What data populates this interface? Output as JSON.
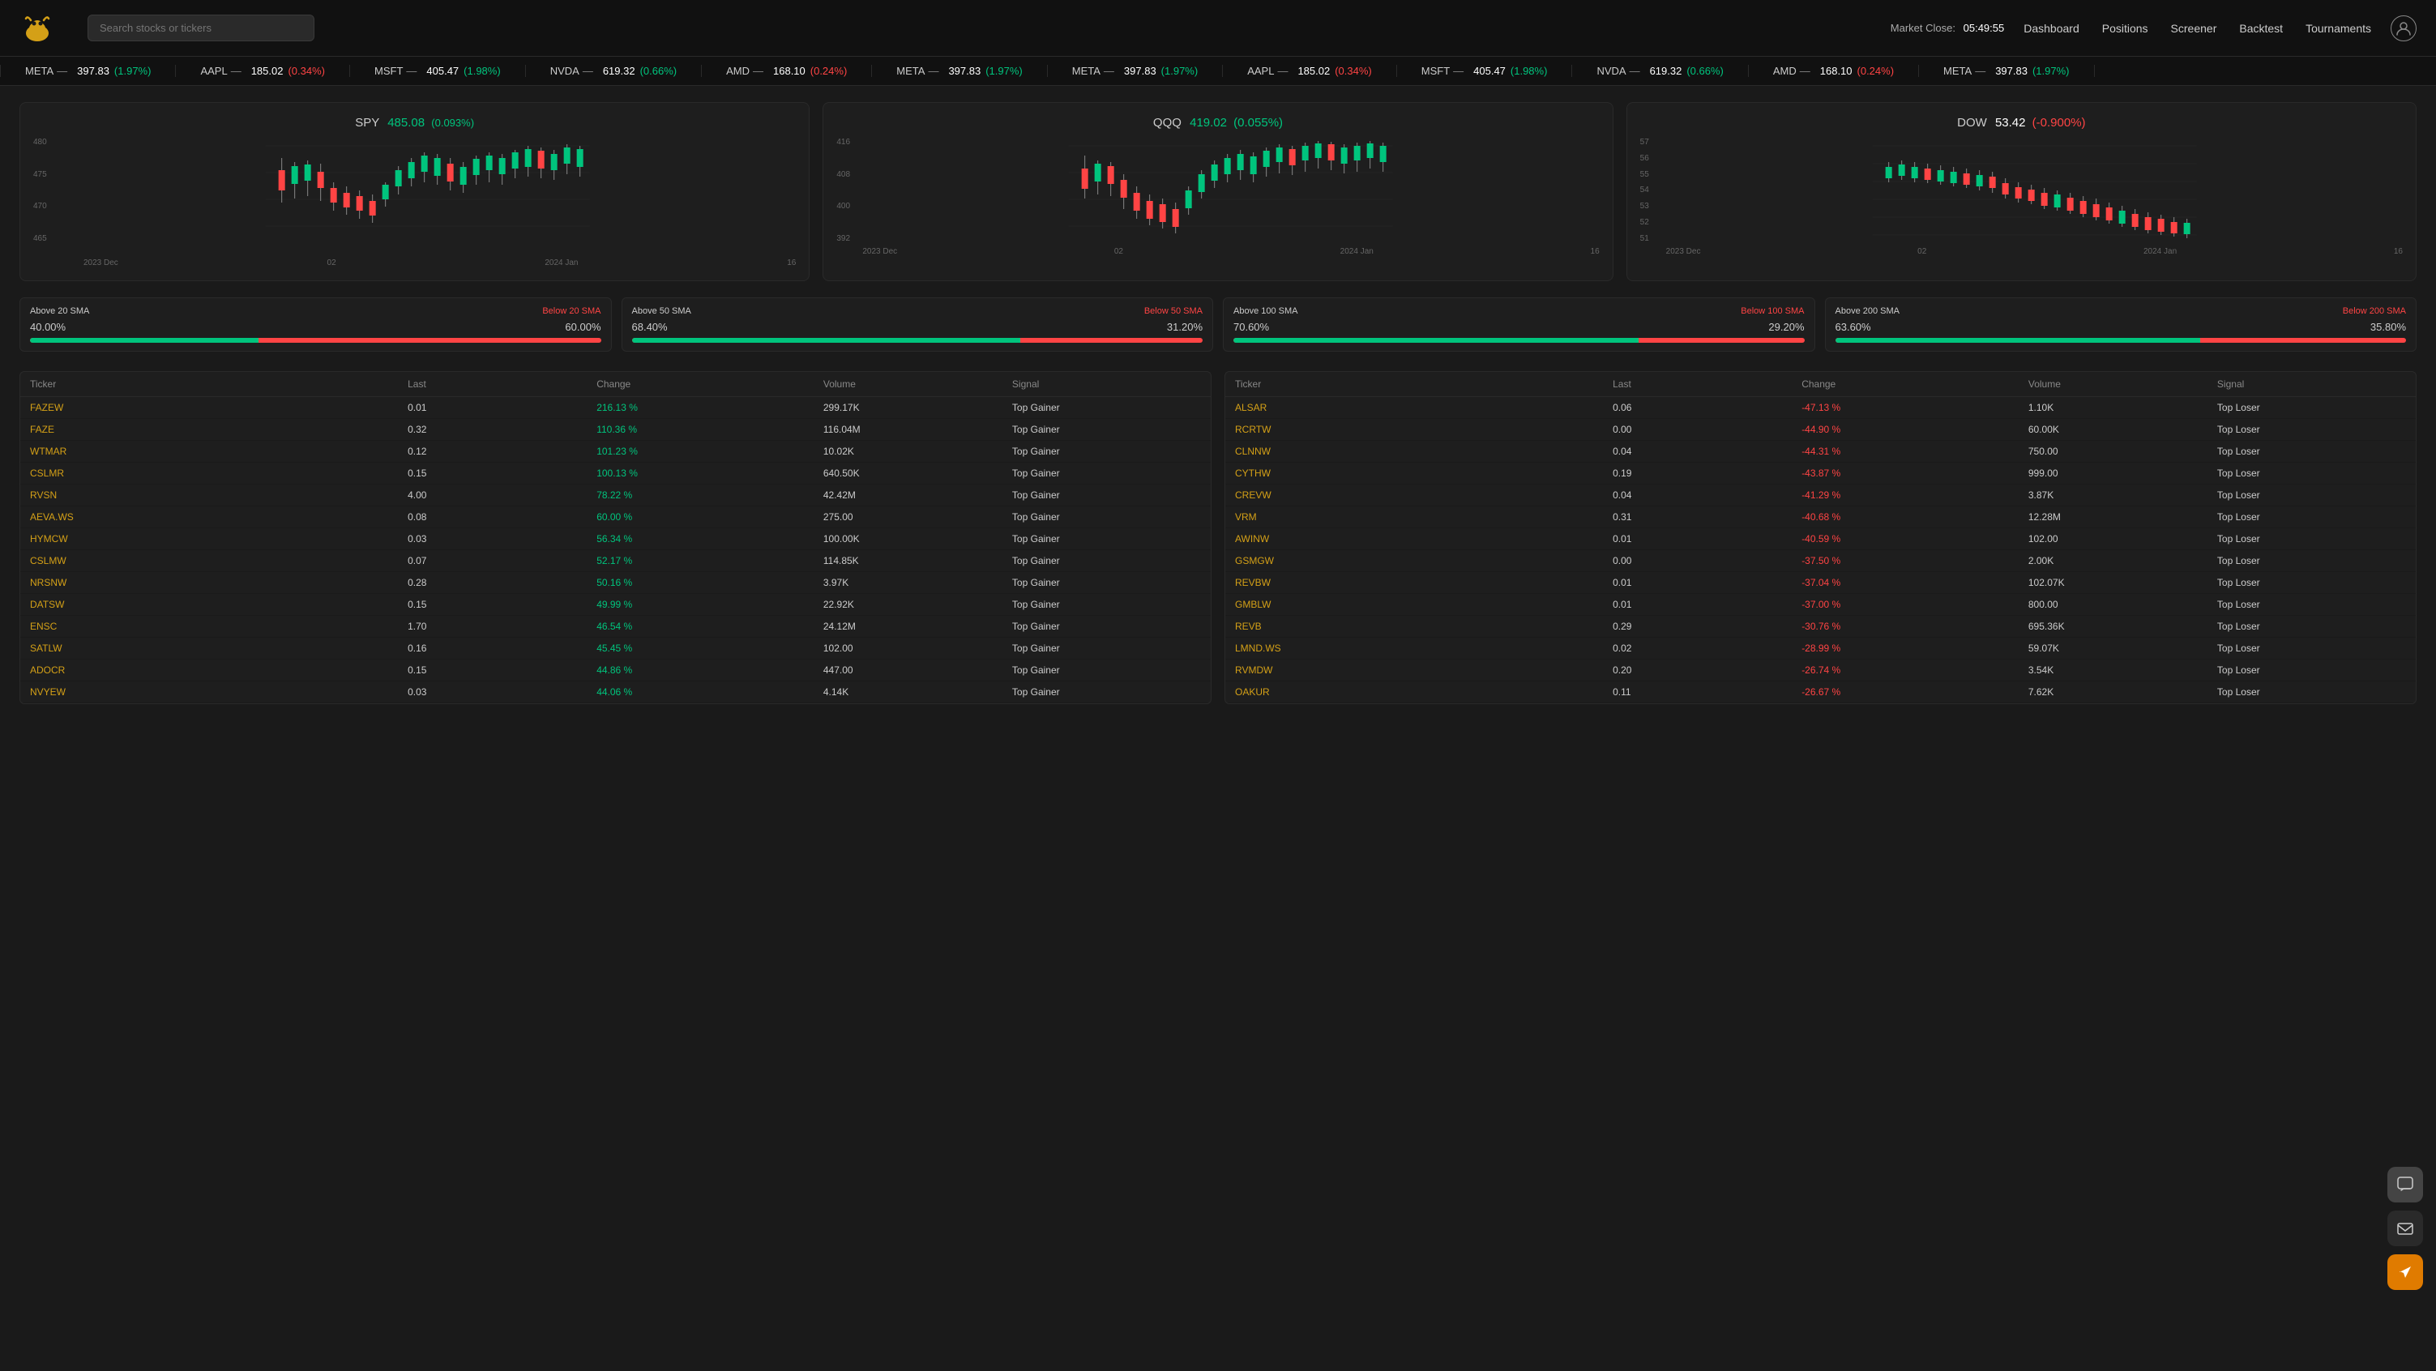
{
  "header": {
    "logo_emoji": "🐂",
    "search_placeholder": "Search stocks or tickers",
    "market_timer_label": "Market Close:",
    "market_timer_value": "05:49:55",
    "nav": [
      "Dashboard",
      "Positions",
      "Screener",
      "Backtest",
      "Tournaments"
    ]
  },
  "ticker_tape": [
    {
      "symbol": "META",
      "price": "397.83",
      "change": "(1.97%)",
      "positive": true
    },
    {
      "symbol": "AAPL",
      "price": "185.02",
      "change": "(0.34%)",
      "positive": false
    },
    {
      "symbol": "MSFT",
      "price": "405.47",
      "change": "(1.98%)",
      "positive": true
    },
    {
      "symbol": "NVDA",
      "price": "619.32",
      "change": "(0.66%)",
      "positive": true
    },
    {
      "symbol": "AMD",
      "price": "168.10",
      "change": "(0.24%)",
      "positive": false
    },
    {
      "symbol": "META",
      "price": "397.83",
      "change": "(1.97%)",
      "positive": true
    }
  ],
  "charts": [
    {
      "symbol": "SPY",
      "price": "485.08",
      "change": "(0.093%)",
      "positive": true,
      "y_labels": [
        "480",
        "475",
        "470",
        "465"
      ],
      "x_labels": [
        "2023 Dec",
        "02",
        "2024 Jan",
        "16"
      ]
    },
    {
      "symbol": "QQQ",
      "price": "419.02",
      "change": "(0.055%)",
      "positive": true,
      "y_labels": [
        "416",
        "408",
        "400",
        "392"
      ],
      "x_labels": [
        "2023 Dec",
        "02",
        "2024 Jan",
        "16"
      ]
    },
    {
      "symbol": "DOW",
      "price": "53.42",
      "change": "(-0.900%)",
      "positive": false,
      "y_labels": [
        "57",
        "56",
        "55",
        "54",
        "53",
        "52",
        "51"
      ],
      "x_labels": [
        "2023 Dec",
        "02",
        "2024 Jan",
        "16"
      ]
    }
  ],
  "sma_bars": [
    {
      "label_above": "Above 20 SMA",
      "label_below": "Below 20 SMA",
      "val_above": "40.00%",
      "val_below": "60.00%",
      "fill_pct": 40
    },
    {
      "label_above": "Above 50 SMA",
      "label_below": "Below 50 SMA",
      "val_above": "68.40%",
      "val_below": "31.20%",
      "fill_pct": 68
    },
    {
      "label_above": "Above 100 SMA",
      "label_below": "Below 100 SMA",
      "val_above": "70.60%",
      "val_below": "29.20%",
      "fill_pct": 71
    },
    {
      "label_above": "Above 200 SMA",
      "label_below": "Below 200 SMA",
      "val_above": "63.60%",
      "val_below": "35.80%",
      "fill_pct": 64
    }
  ],
  "gainers_table": {
    "columns": [
      "Ticker",
      "Last",
      "Change",
      "Volume",
      "Signal"
    ],
    "rows": [
      {
        "ticker": "FAZEW",
        "last": "0.01",
        "change": "216.13 %",
        "volume": "299.17K",
        "signal": "Top Gainer"
      },
      {
        "ticker": "FAZE",
        "last": "0.32",
        "change": "110.36 %",
        "volume": "116.04M",
        "signal": "Top Gainer"
      },
      {
        "ticker": "WTMAR",
        "last": "0.12",
        "change": "101.23 %",
        "volume": "10.02K",
        "signal": "Top Gainer"
      },
      {
        "ticker": "CSLMR",
        "last": "0.15",
        "change": "100.13 %",
        "volume": "640.50K",
        "signal": "Top Gainer"
      },
      {
        "ticker": "RVSN",
        "last": "4.00",
        "change": "78.22 %",
        "volume": "42.42M",
        "signal": "Top Gainer"
      },
      {
        "ticker": "AEVA.WS",
        "last": "0.08",
        "change": "60.00 %",
        "volume": "275.00",
        "signal": "Top Gainer"
      },
      {
        "ticker": "HYMCW",
        "last": "0.03",
        "change": "56.34 %",
        "volume": "100.00K",
        "signal": "Top Gainer"
      },
      {
        "ticker": "CSLMW",
        "last": "0.07",
        "change": "52.17 %",
        "volume": "114.85K",
        "signal": "Top Gainer"
      },
      {
        "ticker": "NRSNW",
        "last": "0.28",
        "change": "50.16 %",
        "volume": "3.97K",
        "signal": "Top Gainer"
      },
      {
        "ticker": "DATSW",
        "last": "0.15",
        "change": "49.99 %",
        "volume": "22.92K",
        "signal": "Top Gainer"
      },
      {
        "ticker": "ENSC",
        "last": "1.70",
        "change": "46.54 %",
        "volume": "24.12M",
        "signal": "Top Gainer"
      },
      {
        "ticker": "SATLW",
        "last": "0.16",
        "change": "45.45 %",
        "volume": "102.00",
        "signal": "Top Gainer"
      },
      {
        "ticker": "ADOCR",
        "last": "0.15",
        "change": "44.86 %",
        "volume": "447.00",
        "signal": "Top Gainer"
      },
      {
        "ticker": "NVYEW",
        "last": "0.03",
        "change": "44.06 %",
        "volume": "4.14K",
        "signal": "Top Gainer"
      }
    ]
  },
  "losers_table": {
    "columns": [
      "Ticker",
      "Last",
      "Change",
      "Volume",
      "Signal"
    ],
    "rows": [
      {
        "ticker": "ALSAR",
        "last": "0.06",
        "change": "-47.13 %",
        "volume": "1.10K",
        "signal": "Top Loser"
      },
      {
        "ticker": "RCRTW",
        "last": "0.00",
        "change": "-44.90 %",
        "volume": "60.00K",
        "signal": "Top Loser"
      },
      {
        "ticker": "CLNNW",
        "last": "0.04",
        "change": "-44.31 %",
        "volume": "750.00",
        "signal": "Top Loser"
      },
      {
        "ticker": "CYTHW",
        "last": "0.19",
        "change": "-43.87 %",
        "volume": "999.00",
        "signal": "Top Loser"
      },
      {
        "ticker": "CREVW",
        "last": "0.04",
        "change": "-41.29 %",
        "volume": "3.87K",
        "signal": "Top Loser"
      },
      {
        "ticker": "VRM",
        "last": "0.31",
        "change": "-40.68 %",
        "volume": "12.28M",
        "signal": "Top Loser"
      },
      {
        "ticker": "AWINW",
        "last": "0.01",
        "change": "-40.59 %",
        "volume": "102.00",
        "signal": "Top Loser"
      },
      {
        "ticker": "GSMGW",
        "last": "0.00",
        "change": "-37.50 %",
        "volume": "2.00K",
        "signal": "Top Loser"
      },
      {
        "ticker": "REVBW",
        "last": "0.01",
        "change": "-37.04 %",
        "volume": "102.07K",
        "signal": "Top Loser"
      },
      {
        "ticker": "GMBLW",
        "last": "0.01",
        "change": "-37.00 %",
        "volume": "800.00",
        "signal": "Top Loser"
      },
      {
        "ticker": "REVB",
        "last": "0.29",
        "change": "-30.76 %",
        "volume": "695.36K",
        "signal": "Top Loser"
      },
      {
        "ticker": "LMND.WS",
        "last": "0.02",
        "change": "-28.99 %",
        "volume": "59.07K",
        "signal": "Top Loser"
      },
      {
        "ticker": "RVMDW",
        "last": "0.20",
        "change": "-26.74 %",
        "volume": "3.54K",
        "signal": "Top Loser"
      },
      {
        "ticker": "OAKUR",
        "last": "0.11",
        "change": "-26.67 %",
        "volume": "7.62K",
        "signal": "Top Loser"
      }
    ]
  },
  "chat_buttons": [
    {
      "icon": "💬",
      "type": "gray"
    },
    {
      "icon": "✉",
      "type": "dark"
    },
    {
      "icon": "➤",
      "type": "orange"
    }
  ]
}
